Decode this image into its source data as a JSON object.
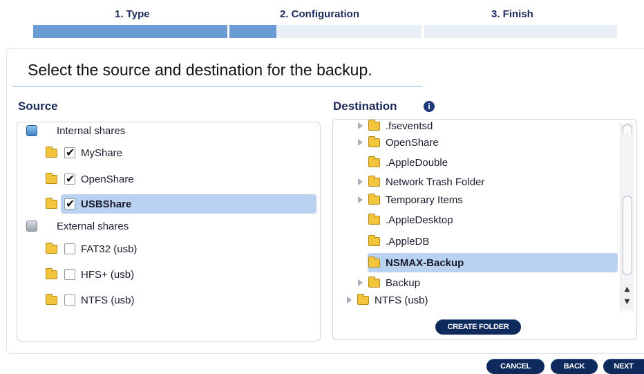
{
  "wizard": {
    "steps": [
      "1. Type",
      "2. Configuration",
      "3. Finish"
    ]
  },
  "headline": "Select the source and destination for the backup.",
  "source": {
    "title": "Source",
    "groups": [
      {
        "label": "Internal shares",
        "items": [
          {
            "label": "MyShare",
            "checked": true
          },
          {
            "label": "OpenShare",
            "checked": true
          },
          {
            "label": "USBShare",
            "checked": true,
            "selected": true
          }
        ]
      },
      {
        "label": "External shares",
        "items": [
          {
            "label": "FAT32 (usb)",
            "checked": false
          },
          {
            "label": "HFS+ (usb)",
            "checked": false
          },
          {
            "label": "NTFS (usb)",
            "checked": false
          }
        ]
      }
    ]
  },
  "destination": {
    "title": "Destination",
    "items": [
      {
        "label": ".fseventsd",
        "expandable": true
      },
      {
        "label": "OpenShare",
        "expandable": true
      },
      {
        "label": ".AppleDouble",
        "expandable": false
      },
      {
        "label": "Network Trash Folder",
        "expandable": true
      },
      {
        "label": "Temporary Items",
        "expandable": true
      },
      {
        "label": ".AppleDesktop",
        "expandable": false
      },
      {
        "label": ".AppleDB",
        "expandable": false
      },
      {
        "label": "NSMAX-Backup",
        "expandable": false,
        "selected": true
      },
      {
        "label": "Backup",
        "expandable": true
      },
      {
        "label": "NTFS (usb)",
        "expandable": true
      }
    ],
    "create_folder_label": "CREATE FOLDER"
  },
  "footer": {
    "cancel_label": "CANCEL",
    "back_label": "BACK",
    "next_label": "NEXT"
  }
}
